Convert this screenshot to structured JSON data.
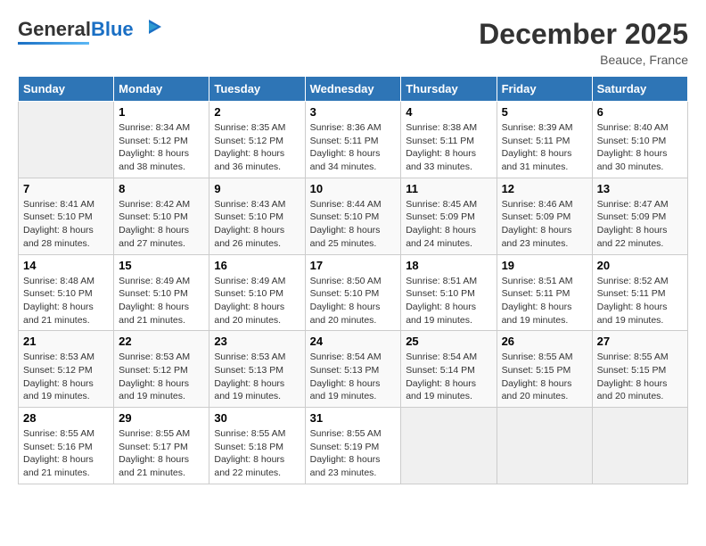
{
  "header": {
    "logo_general": "General",
    "logo_blue": "Blue",
    "month_year": "December 2025",
    "location": "Beauce, France"
  },
  "weekdays": [
    "Sunday",
    "Monday",
    "Tuesday",
    "Wednesday",
    "Thursday",
    "Friday",
    "Saturday"
  ],
  "weeks": [
    [
      {
        "day": "",
        "sunrise": "",
        "sunset": "",
        "daylight": ""
      },
      {
        "day": "1",
        "sunrise": "Sunrise: 8:34 AM",
        "sunset": "Sunset: 5:12 PM",
        "daylight": "Daylight: 8 hours and 38 minutes."
      },
      {
        "day": "2",
        "sunrise": "Sunrise: 8:35 AM",
        "sunset": "Sunset: 5:12 PM",
        "daylight": "Daylight: 8 hours and 36 minutes."
      },
      {
        "day": "3",
        "sunrise": "Sunrise: 8:36 AM",
        "sunset": "Sunset: 5:11 PM",
        "daylight": "Daylight: 8 hours and 34 minutes."
      },
      {
        "day": "4",
        "sunrise": "Sunrise: 8:38 AM",
        "sunset": "Sunset: 5:11 PM",
        "daylight": "Daylight: 8 hours and 33 minutes."
      },
      {
        "day": "5",
        "sunrise": "Sunrise: 8:39 AM",
        "sunset": "Sunset: 5:11 PM",
        "daylight": "Daylight: 8 hours and 31 minutes."
      },
      {
        "day": "6",
        "sunrise": "Sunrise: 8:40 AM",
        "sunset": "Sunset: 5:10 PM",
        "daylight": "Daylight: 8 hours and 30 minutes."
      }
    ],
    [
      {
        "day": "7",
        "sunrise": "Sunrise: 8:41 AM",
        "sunset": "Sunset: 5:10 PM",
        "daylight": "Daylight: 8 hours and 28 minutes."
      },
      {
        "day": "8",
        "sunrise": "Sunrise: 8:42 AM",
        "sunset": "Sunset: 5:10 PM",
        "daylight": "Daylight: 8 hours and 27 minutes."
      },
      {
        "day": "9",
        "sunrise": "Sunrise: 8:43 AM",
        "sunset": "Sunset: 5:10 PM",
        "daylight": "Daylight: 8 hours and 26 minutes."
      },
      {
        "day": "10",
        "sunrise": "Sunrise: 8:44 AM",
        "sunset": "Sunset: 5:10 PM",
        "daylight": "Daylight: 8 hours and 25 minutes."
      },
      {
        "day": "11",
        "sunrise": "Sunrise: 8:45 AM",
        "sunset": "Sunset: 5:09 PM",
        "daylight": "Daylight: 8 hours and 24 minutes."
      },
      {
        "day": "12",
        "sunrise": "Sunrise: 8:46 AM",
        "sunset": "Sunset: 5:09 PM",
        "daylight": "Daylight: 8 hours and 23 minutes."
      },
      {
        "day": "13",
        "sunrise": "Sunrise: 8:47 AM",
        "sunset": "Sunset: 5:09 PM",
        "daylight": "Daylight: 8 hours and 22 minutes."
      }
    ],
    [
      {
        "day": "14",
        "sunrise": "Sunrise: 8:48 AM",
        "sunset": "Sunset: 5:10 PM",
        "daylight": "Daylight: 8 hours and 21 minutes."
      },
      {
        "day": "15",
        "sunrise": "Sunrise: 8:49 AM",
        "sunset": "Sunset: 5:10 PM",
        "daylight": "Daylight: 8 hours and 21 minutes."
      },
      {
        "day": "16",
        "sunrise": "Sunrise: 8:49 AM",
        "sunset": "Sunset: 5:10 PM",
        "daylight": "Daylight: 8 hours and 20 minutes."
      },
      {
        "day": "17",
        "sunrise": "Sunrise: 8:50 AM",
        "sunset": "Sunset: 5:10 PM",
        "daylight": "Daylight: 8 hours and 20 minutes."
      },
      {
        "day": "18",
        "sunrise": "Sunrise: 8:51 AM",
        "sunset": "Sunset: 5:10 PM",
        "daylight": "Daylight: 8 hours and 19 minutes."
      },
      {
        "day": "19",
        "sunrise": "Sunrise: 8:51 AM",
        "sunset": "Sunset: 5:11 PM",
        "daylight": "Daylight: 8 hours and 19 minutes."
      },
      {
        "day": "20",
        "sunrise": "Sunrise: 8:52 AM",
        "sunset": "Sunset: 5:11 PM",
        "daylight": "Daylight: 8 hours and 19 minutes."
      }
    ],
    [
      {
        "day": "21",
        "sunrise": "Sunrise: 8:53 AM",
        "sunset": "Sunset: 5:12 PM",
        "daylight": "Daylight: 8 hours and 19 minutes."
      },
      {
        "day": "22",
        "sunrise": "Sunrise: 8:53 AM",
        "sunset": "Sunset: 5:12 PM",
        "daylight": "Daylight: 8 hours and 19 minutes."
      },
      {
        "day": "23",
        "sunrise": "Sunrise: 8:53 AM",
        "sunset": "Sunset: 5:13 PM",
        "daylight": "Daylight: 8 hours and 19 minutes."
      },
      {
        "day": "24",
        "sunrise": "Sunrise: 8:54 AM",
        "sunset": "Sunset: 5:13 PM",
        "daylight": "Daylight: 8 hours and 19 minutes."
      },
      {
        "day": "25",
        "sunrise": "Sunrise: 8:54 AM",
        "sunset": "Sunset: 5:14 PM",
        "daylight": "Daylight: 8 hours and 19 minutes."
      },
      {
        "day": "26",
        "sunrise": "Sunrise: 8:55 AM",
        "sunset": "Sunset: 5:15 PM",
        "daylight": "Daylight: 8 hours and 20 minutes."
      },
      {
        "day": "27",
        "sunrise": "Sunrise: 8:55 AM",
        "sunset": "Sunset: 5:15 PM",
        "daylight": "Daylight: 8 hours and 20 minutes."
      }
    ],
    [
      {
        "day": "28",
        "sunrise": "Sunrise: 8:55 AM",
        "sunset": "Sunset: 5:16 PM",
        "daylight": "Daylight: 8 hours and 21 minutes."
      },
      {
        "day": "29",
        "sunrise": "Sunrise: 8:55 AM",
        "sunset": "Sunset: 5:17 PM",
        "daylight": "Daylight: 8 hours and 21 minutes."
      },
      {
        "day": "30",
        "sunrise": "Sunrise: 8:55 AM",
        "sunset": "Sunset: 5:18 PM",
        "daylight": "Daylight: 8 hours and 22 minutes."
      },
      {
        "day": "31",
        "sunrise": "Sunrise: 8:55 AM",
        "sunset": "Sunset: 5:19 PM",
        "daylight": "Daylight: 8 hours and 23 minutes."
      },
      {
        "day": "",
        "sunrise": "",
        "sunset": "",
        "daylight": ""
      },
      {
        "day": "",
        "sunrise": "",
        "sunset": "",
        "daylight": ""
      },
      {
        "day": "",
        "sunrise": "",
        "sunset": "",
        "daylight": ""
      }
    ]
  ]
}
